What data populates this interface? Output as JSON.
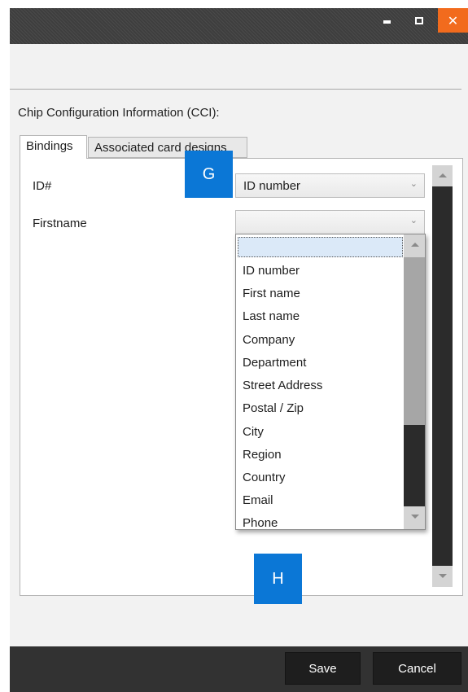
{
  "window": {
    "close_glyph": "✕",
    "controls": [
      "minimize-icon",
      "maximize-icon",
      "close-icon"
    ],
    "close_color": "#f26b1d"
  },
  "section": {
    "cci_label": "Chip Configuration Information (CCI):"
  },
  "tabs": [
    {
      "label": "Bindings",
      "selected": true
    },
    {
      "label": "Associated card designs",
      "selected": false
    }
  ],
  "bindings": [
    {
      "label": "ID#",
      "value": "ID number"
    },
    {
      "label": "Firstname",
      "value": ""
    }
  ],
  "dropdown": {
    "open": true,
    "highlighted_value": "",
    "options": [
      "ID number",
      "First name",
      "Last name",
      "Company",
      "Department",
      "Street Address",
      "Postal / Zip",
      "City",
      "Region",
      "Country",
      "Email",
      "Phone"
    ]
  },
  "markers": {
    "g": "G",
    "h": "H",
    "color": "#0b77d6"
  },
  "footer": {
    "save_label": "Save",
    "cancel_label": "Cancel"
  }
}
